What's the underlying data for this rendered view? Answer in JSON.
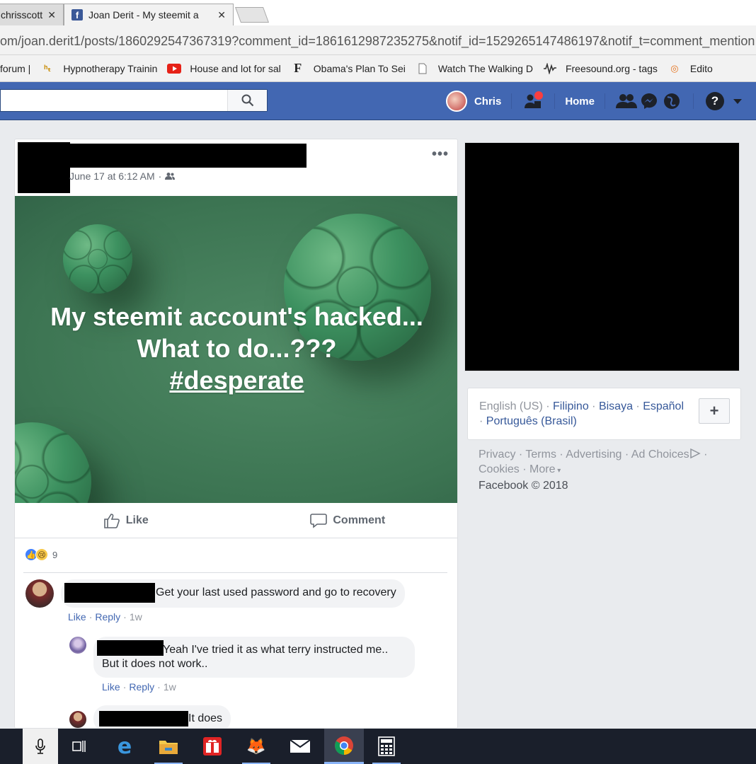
{
  "browser": {
    "tabs": [
      {
        "title": "chrisscott",
        "active": false
      },
      {
        "title": "Joan Derit - My steemit a",
        "active": true
      }
    ],
    "url": "om/joan.derit1/posts/1860292547367319?comment_id=1861612987235275&notif_id=1529265147486197&notif_t=comment_mention",
    "bookmarks": [
      {
        "label": "forum |",
        "icon": "page-icon"
      },
      {
        "label": "Hypnotherapy Trainin",
        "icon": "htb-icon"
      },
      {
        "label": "House and lot for sal",
        "icon": "youtube-icon"
      },
      {
        "label": "Obama's Plan To Sei",
        "icon": "forbes-icon"
      },
      {
        "label": "Watch The Walking D",
        "icon": "page-icon"
      },
      {
        "label": "Freesound.org - tags",
        "icon": "freesound-icon"
      },
      {
        "label": "Edito",
        "icon": "edit-icon"
      }
    ]
  },
  "fb_header": {
    "user_name": "Chris",
    "home_label": "Home",
    "help_glyph": "?"
  },
  "post": {
    "timestamp": "June 17 at 6:12 AM",
    "audience_sep": "·",
    "banner_lines": [
      "My steemit account's hacked...",
      "What to do...???",
      "#desperate"
    ],
    "like_label": "Like",
    "comment_label": "Comment",
    "reaction_count": "9"
  },
  "comments": [
    {
      "text": "Get your last used password and go to recovery",
      "like": "Like",
      "reply": "Reply",
      "time": "1w"
    },
    {
      "text_line1": "Yeah I've tried it as what terry instructed me..",
      "text_line2": "But it does not work..",
      "like": "Like",
      "reply": "Reply",
      "time": "1w"
    },
    {
      "text": "It does"
    }
  ],
  "sidebar": {
    "languages": {
      "current": "English (US)",
      "links": [
        "Filipino",
        "Bisaya",
        "Español",
        "Português (Brasil)"
      ],
      "plus": "+"
    },
    "footer_links_line1": [
      "Privacy",
      "Terms",
      "Advertising",
      "Ad Choices"
    ],
    "footer_links_line2": [
      "Cookies",
      "More"
    ],
    "copyright": "Facebook © 2018"
  },
  "colors": {
    "fb_blue": "#4267b2",
    "link_blue": "#365899",
    "banner_green": "#3c7452"
  }
}
